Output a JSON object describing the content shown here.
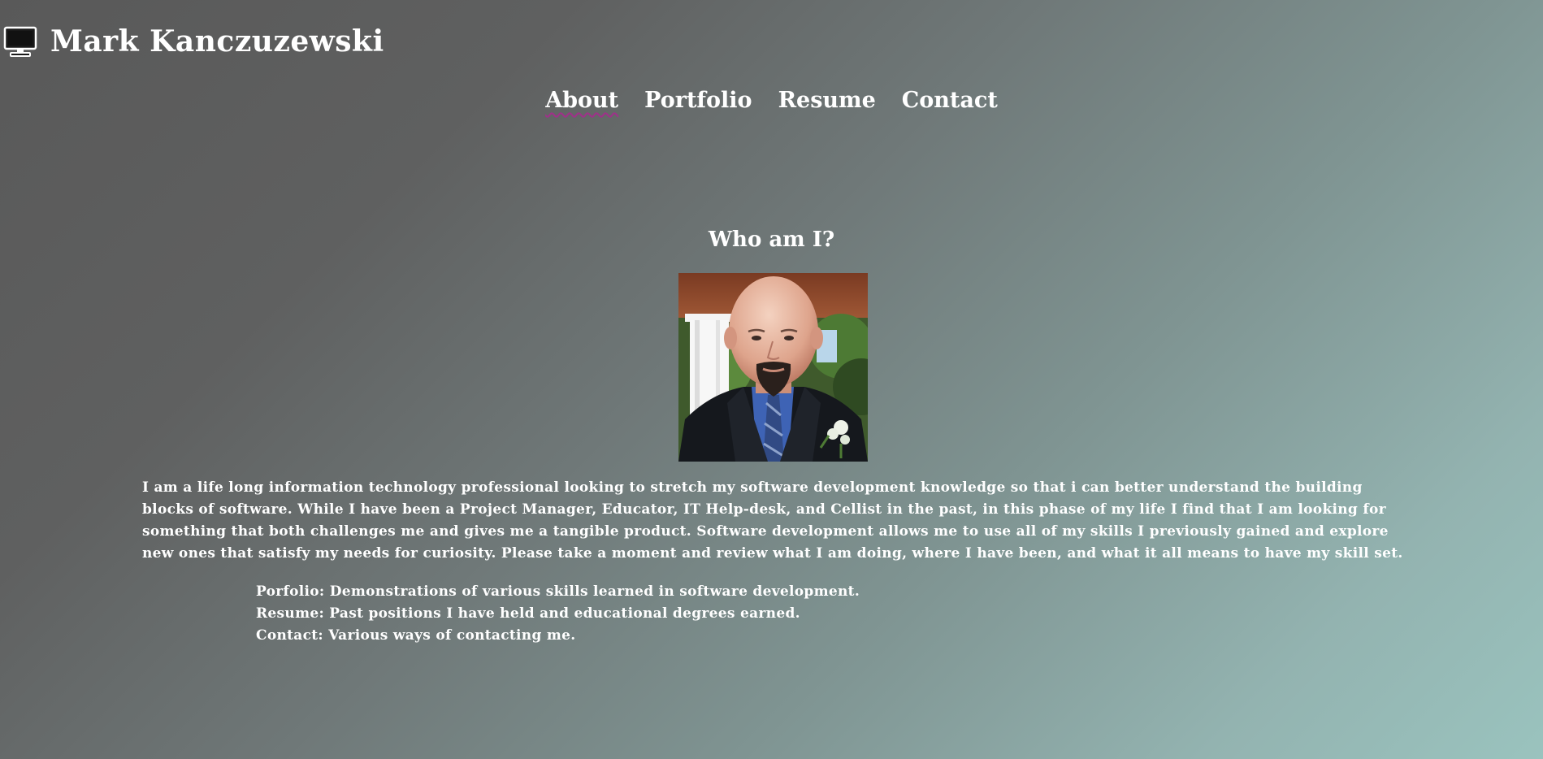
{
  "site": {
    "title": "Mark Kanczuzewski",
    "logo_icon": "monitor-icon"
  },
  "nav": {
    "items": [
      {
        "label": "About",
        "active": true
      },
      {
        "label": "Portfolio",
        "active": false
      },
      {
        "label": "Resume",
        "active": false
      },
      {
        "label": "Contact",
        "active": false
      }
    ]
  },
  "main": {
    "heading": "Who am I?",
    "bio": "I am a life long information technology professional looking to stretch my software development knowledge so that i can better understand the building blocks of software. While I have been a Project Manager, Educator, IT Help-desk, and Cellist in the past, in this phase of my life I find that I am looking for something that both challenges me and gives me a tangible product. Software development allows me to use all of my skills I previously gained and explore new ones that satisfy my needs for curiosity. Please take a moment and review what I am doing, where I have been, and what it all means to have my skill set.",
    "links": [
      "Porfolio: Demonstrations of various skills learned in software development.",
      "Resume: Past positions I have held and educational degrees earned.",
      "Contact: Various ways of contacting me."
    ]
  },
  "colors": {
    "text": "#ffffff",
    "nav_underline": "#a0308a",
    "bg_start": "#595959",
    "bg_end": "#9ac3be"
  }
}
